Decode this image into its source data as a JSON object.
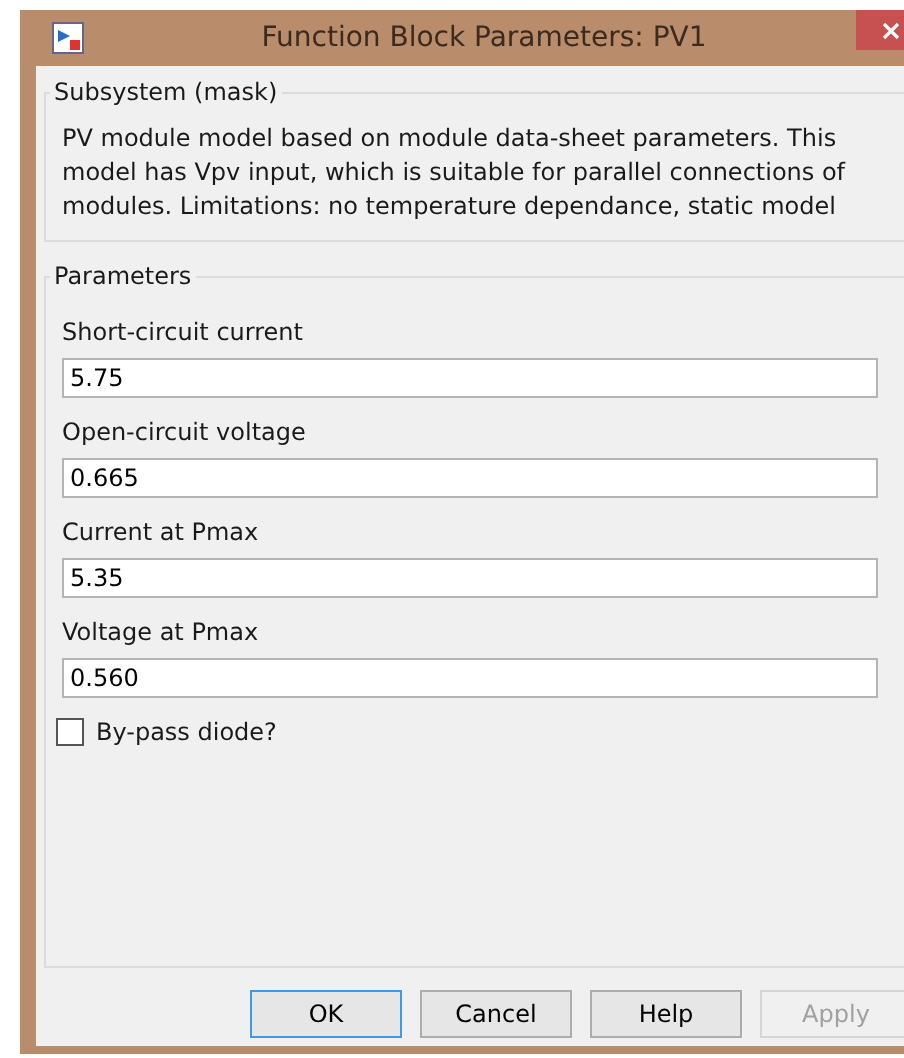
{
  "window": {
    "title": "Function Block Parameters: PV1"
  },
  "description_group": {
    "title": "Subsystem (mask)",
    "text": "PV module model based on module data-sheet parameters. This model has Vpv input, which is suitable for parallel connections of modules. Limitations: no temperature dependance, static model"
  },
  "parameters_group": {
    "title": "Parameters",
    "fields": [
      {
        "label": "Short-circuit current",
        "value": "5.75"
      },
      {
        "label": "Open-circuit voltage",
        "value": "0.665"
      },
      {
        "label": "Current at Pmax",
        "value": "5.35"
      },
      {
        "label": "Voltage at Pmax",
        "value": "0.560"
      }
    ],
    "checkbox": {
      "label": "By-pass diode?",
      "checked": false
    }
  },
  "buttons": [
    {
      "label": "OK",
      "default": true,
      "disabled": false
    },
    {
      "label": "Cancel",
      "default": false,
      "disabled": false
    },
    {
      "label": "Help",
      "default": false,
      "disabled": false
    },
    {
      "label": "Apply",
      "default": false,
      "disabled": true
    }
  ]
}
